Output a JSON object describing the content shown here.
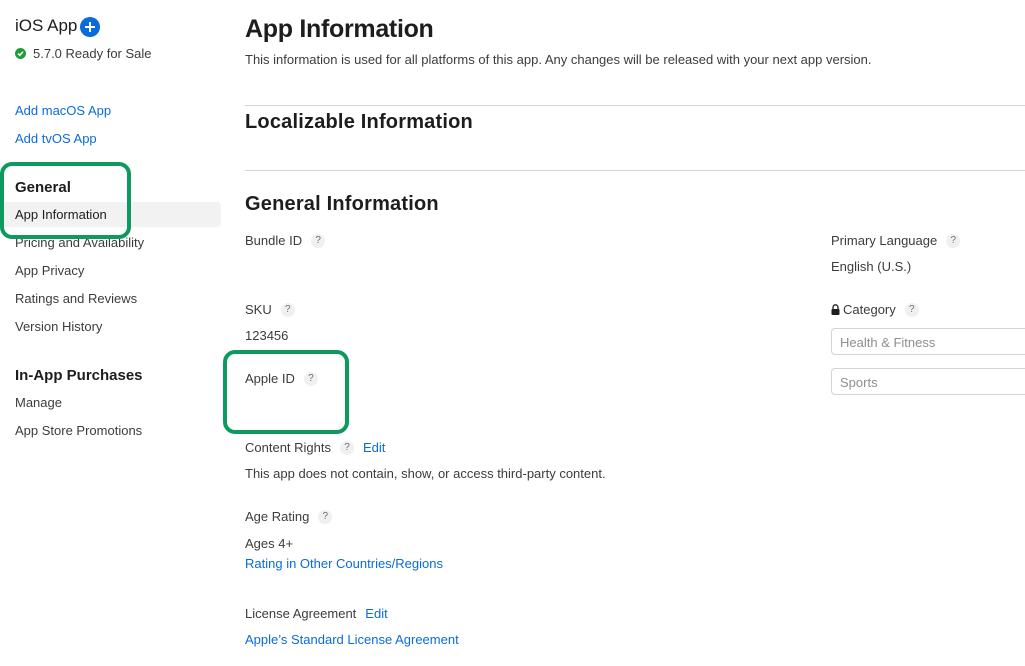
{
  "sidebar": {
    "app_title": "iOS App",
    "status": "5.7.0 Ready for Sale",
    "add_links": [
      "Add macOS App",
      "Add tvOS App"
    ],
    "general": {
      "heading": "General",
      "items": [
        "App Information",
        "Pricing and Availability",
        "App Privacy",
        "Ratings and Reviews",
        "Version History"
      ]
    },
    "iap": {
      "heading": "In-App Purchases",
      "items": [
        "Manage",
        "App Store Promotions"
      ]
    }
  },
  "main": {
    "title": "App Information",
    "description": "This information is used for all platforms of this app. Any changes will be released with your next app version.",
    "localizable_title": "Localizable Information",
    "general_title": "General Information",
    "bundle_id_label": "Bundle ID",
    "bundle_id_value": "",
    "sku_label": "SKU",
    "sku_value": "123456",
    "apple_id_label": "Apple ID",
    "apple_id_value": "",
    "content_rights_label": "Content Rights",
    "content_rights_edit": "Edit",
    "content_rights_value": "This app does not contain, show, or access third-party content.",
    "age_rating_label": "Age Rating",
    "age_rating_value": "Ages 4+",
    "age_rating_link": "Rating in Other Countries/Regions",
    "license_label": "License Agreement",
    "license_edit": "Edit",
    "license_link": "Apple’s Standard License Agreement",
    "primary_language_label": "Primary Language",
    "primary_language_value": "English (U.S.)",
    "category_label": "Category",
    "category_primary": "Health & Fitness",
    "category_secondary": "Sports",
    "help_glyph": "?"
  },
  "colors": {
    "link": "#0a6bdc",
    "highlight": "#0e9a5e",
    "status_ok": "#1f9d39"
  }
}
